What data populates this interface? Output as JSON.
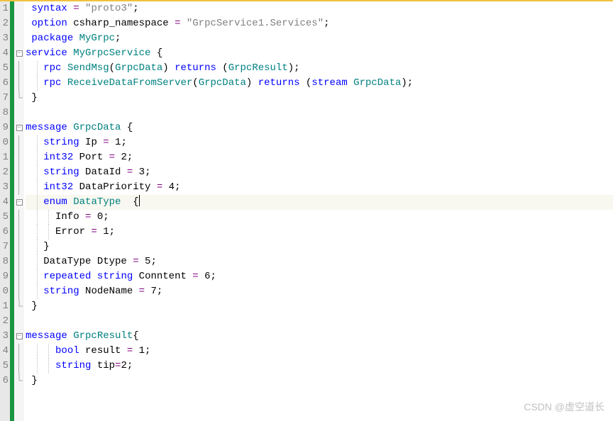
{
  "watermark": "CSDN @虚空道长",
  "lines": [
    {
      "n": "1",
      "fold": "",
      "tokens": [
        {
          "t": " ",
          "c": ""
        },
        {
          "t": "syntax",
          "c": "kw"
        },
        {
          "t": " ",
          "c": ""
        },
        {
          "t": "=",
          "c": "op"
        },
        {
          "t": " ",
          "c": ""
        },
        {
          "t": "\"proto3\"",
          "c": "str"
        },
        {
          "t": ";",
          "c": "punct"
        }
      ]
    },
    {
      "n": "2",
      "fold": "",
      "tokens": [
        {
          "t": " ",
          "c": ""
        },
        {
          "t": "option",
          "c": "kw"
        },
        {
          "t": " csharp_namespace ",
          "c": ""
        },
        {
          "t": "=",
          "c": "op"
        },
        {
          "t": " ",
          "c": ""
        },
        {
          "t": "\"GrpcService1.Services\"",
          "c": "str"
        },
        {
          "t": ";",
          "c": "punct"
        }
      ]
    },
    {
      "n": "3",
      "fold": "",
      "tokens": [
        {
          "t": " ",
          "c": ""
        },
        {
          "t": "package",
          "c": "kw"
        },
        {
          "t": " ",
          "c": ""
        },
        {
          "t": "MyGrpc",
          "c": "ident"
        },
        {
          "t": ";",
          "c": "punct"
        }
      ]
    },
    {
      "n": "4",
      "fold": "minus",
      "tokens": [
        {
          "t": "service",
          "c": "kw"
        },
        {
          "t": " ",
          "c": ""
        },
        {
          "t": "MyGrpcService",
          "c": "ident"
        },
        {
          "t": " {",
          "c": "punct"
        }
      ]
    },
    {
      "n": "5",
      "fold": "bar",
      "tokens": [
        {
          "t": "   ",
          "c": ""
        },
        {
          "t": "rpc",
          "c": "kw"
        },
        {
          "t": " ",
          "c": ""
        },
        {
          "t": "SendMsg",
          "c": "ident"
        },
        {
          "t": "(",
          "c": "punct"
        },
        {
          "t": "GrpcData",
          "c": "ident"
        },
        {
          "t": ") ",
          "c": "punct"
        },
        {
          "t": "returns",
          "c": "kw"
        },
        {
          "t": " (",
          "c": "punct"
        },
        {
          "t": "GrpcResult",
          "c": "ident"
        },
        {
          "t": ");",
          "c": "punct"
        }
      ]
    },
    {
      "n": "6",
      "fold": "bar",
      "tokens": [
        {
          "t": "   ",
          "c": ""
        },
        {
          "t": "rpc",
          "c": "kw"
        },
        {
          "t": " ",
          "c": ""
        },
        {
          "t": "ReceiveDataFromServer",
          "c": "ident"
        },
        {
          "t": "(",
          "c": "punct"
        },
        {
          "t": "GrpcData",
          "c": "ident"
        },
        {
          "t": ") ",
          "c": "punct"
        },
        {
          "t": "returns",
          "c": "kw"
        },
        {
          "t": " (",
          "c": "punct"
        },
        {
          "t": "stream",
          "c": "kw"
        },
        {
          "t": " ",
          "c": ""
        },
        {
          "t": "GrpcData",
          "c": "ident"
        },
        {
          "t": ");",
          "c": "punct"
        }
      ]
    },
    {
      "n": "7",
      "fold": "end",
      "tokens": [
        {
          "t": " }",
          "c": "punct"
        }
      ]
    },
    {
      "n": "8",
      "fold": "",
      "tokens": []
    },
    {
      "n": "9",
      "fold": "minus",
      "tokens": [
        {
          "t": "message",
          "c": "kw"
        },
        {
          "t": " ",
          "c": ""
        },
        {
          "t": "GrpcData",
          "c": "ident"
        },
        {
          "t": " {",
          "c": "punct"
        }
      ]
    },
    {
      "n": "0",
      "fold": "bar",
      "tokens": [
        {
          "t": "   ",
          "c": ""
        },
        {
          "t": "string",
          "c": "type"
        },
        {
          "t": " Ip ",
          "c": ""
        },
        {
          "t": "=",
          "c": "op"
        },
        {
          "t": " 1;",
          "c": "punct"
        }
      ]
    },
    {
      "n": "1",
      "fold": "bar",
      "tokens": [
        {
          "t": "   ",
          "c": ""
        },
        {
          "t": "int32",
          "c": "type"
        },
        {
          "t": " Port ",
          "c": ""
        },
        {
          "t": "=",
          "c": "op"
        },
        {
          "t": " 2;",
          "c": "punct"
        }
      ]
    },
    {
      "n": "2",
      "fold": "bar",
      "tokens": [
        {
          "t": "   ",
          "c": ""
        },
        {
          "t": "string",
          "c": "type"
        },
        {
          "t": " DataId ",
          "c": ""
        },
        {
          "t": "=",
          "c": "op"
        },
        {
          "t": " 3;",
          "c": "punct"
        }
      ]
    },
    {
      "n": "3",
      "fold": "bar",
      "tokens": [
        {
          "t": "   ",
          "c": ""
        },
        {
          "t": "int32",
          "c": "type"
        },
        {
          "t": " DataPriority ",
          "c": ""
        },
        {
          "t": "=",
          "c": "op"
        },
        {
          "t": " 4;",
          "c": "punct"
        }
      ]
    },
    {
      "n": "4",
      "fold": "minus",
      "current": true,
      "tokens": [
        {
          "t": "   ",
          "c": ""
        },
        {
          "t": "enum",
          "c": "kw"
        },
        {
          "t": " ",
          "c": ""
        },
        {
          "t": "DataType",
          "c": "ident"
        },
        {
          "t": "  {",
          "c": "punct"
        },
        {
          "cursor": true
        }
      ]
    },
    {
      "n": "5",
      "fold": "bar2",
      "tokens": [
        {
          "t": "     Info ",
          "c": ""
        },
        {
          "t": "=",
          "c": "op"
        },
        {
          "t": " 0;",
          "c": "punct"
        }
      ]
    },
    {
      "n": "6",
      "fold": "bar2",
      "tokens": [
        {
          "t": "     Error ",
          "c": ""
        },
        {
          "t": "=",
          "c": "op"
        },
        {
          "t": " 1;",
          "c": "punct"
        }
      ]
    },
    {
      "n": "7",
      "fold": "bar",
      "tokens": [
        {
          "t": "   }",
          "c": "punct"
        }
      ]
    },
    {
      "n": "8",
      "fold": "bar",
      "tokens": [
        {
          "t": "   DataType Dtype ",
          "c": ""
        },
        {
          "t": "=",
          "c": "op"
        },
        {
          "t": " 5;",
          "c": "punct"
        }
      ]
    },
    {
      "n": "9",
      "fold": "bar",
      "tokens": [
        {
          "t": "   ",
          "c": ""
        },
        {
          "t": "repeated",
          "c": "kw"
        },
        {
          "t": " ",
          "c": ""
        },
        {
          "t": "string",
          "c": "type"
        },
        {
          "t": " Conntent ",
          "c": ""
        },
        {
          "t": "=",
          "c": "op"
        },
        {
          "t": " 6;",
          "c": "punct"
        }
      ]
    },
    {
      "n": "0",
      "fold": "bar",
      "tokens": [
        {
          "t": "   ",
          "c": ""
        },
        {
          "t": "string",
          "c": "type"
        },
        {
          "t": " NodeName ",
          "c": ""
        },
        {
          "t": "=",
          "c": "op"
        },
        {
          "t": " 7;",
          "c": "punct"
        }
      ]
    },
    {
      "n": "1",
      "fold": "end",
      "tokens": [
        {
          "t": " }",
          "c": "punct"
        }
      ]
    },
    {
      "n": "2",
      "fold": "",
      "tokens": []
    },
    {
      "n": "3",
      "fold": "minus",
      "tokens": [
        {
          "t": "message",
          "c": "kw"
        },
        {
          "t": " ",
          "c": ""
        },
        {
          "t": "GrpcResult",
          "c": "ident"
        },
        {
          "t": "{",
          "c": "punct"
        }
      ]
    },
    {
      "n": "4",
      "fold": "bar",
      "tokens": [
        {
          "t": "     ",
          "c": ""
        },
        {
          "t": "bool",
          "c": "type"
        },
        {
          "t": " result ",
          "c": ""
        },
        {
          "t": "=",
          "c": "op"
        },
        {
          "t": " 1;",
          "c": "punct"
        }
      ]
    },
    {
      "n": "5",
      "fold": "bar",
      "tokens": [
        {
          "t": "     ",
          "c": ""
        },
        {
          "t": "string",
          "c": "type"
        },
        {
          "t": " tip",
          "c": ""
        },
        {
          "t": "=",
          "c": "op"
        },
        {
          "t": "2;",
          "c": "punct"
        }
      ]
    },
    {
      "n": "6",
      "fold": "end",
      "tokens": [
        {
          "t": " }",
          "c": "punct"
        }
      ]
    }
  ]
}
